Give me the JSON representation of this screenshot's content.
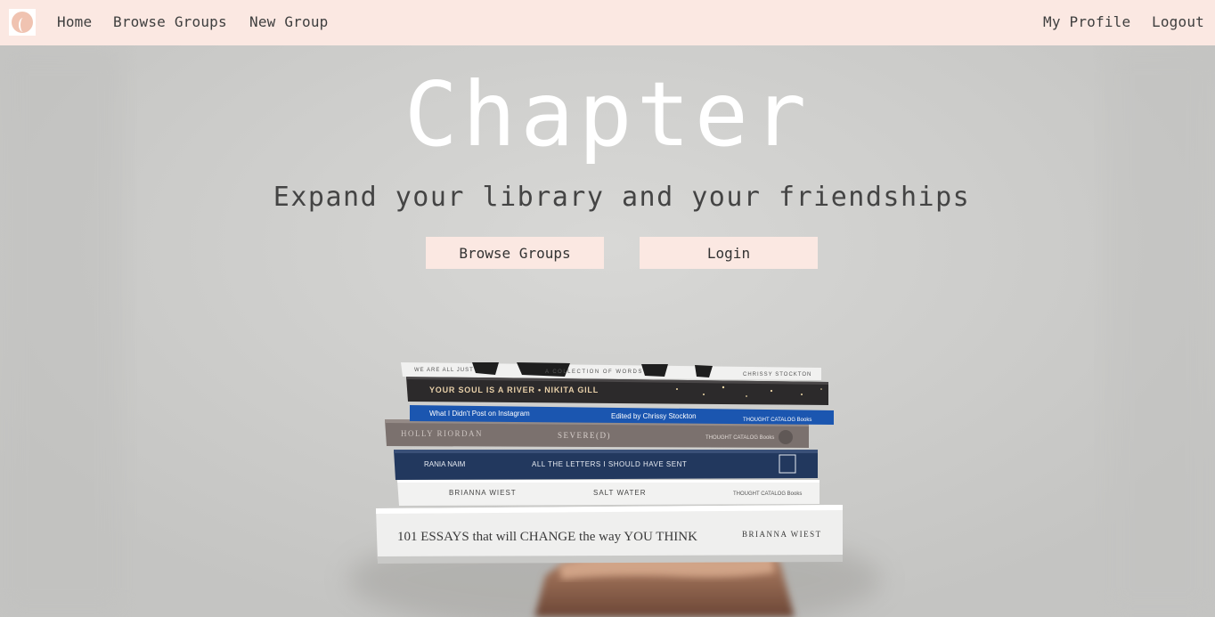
{
  "nav": {
    "logo_icon": "crescent-moon-logo-icon",
    "home": "Home",
    "browse_groups": "Browse Groups",
    "new_group": "New Group",
    "my_profile": "My Profile",
    "logout": "Logout"
  },
  "hero": {
    "title": "Chapter",
    "subtitle": "Expand your library and your friendships",
    "browse_button": "Browse Groups",
    "login_button": "Login"
  },
  "books": [
    {
      "spine_left": "WE ARE ALL JUST",
      "spine_mid": "A COLLECTION OF WORDS",
      "spine_right": "CHRISSY STOCKTON"
    },
    {
      "spine_left": "YOUR SOUL IS A RIVER  •  NIKITA GILL",
      "spine_mid": "",
      "spine_right": ""
    },
    {
      "spine_left": "What I Didn't Post on Instagram",
      "spine_mid": "Edited by Chrissy Stockton",
      "spine_right": "THOUGHT CATALOG Books"
    },
    {
      "spine_left": "HOLLY RIORDAN",
      "spine_mid": "SEVERE(D)",
      "spine_right": "THOUGHT CATALOG Books"
    },
    {
      "spine_left": "RANIA NAIM",
      "spine_mid": "ALL THE LETTERS I SHOULD HAVE SENT",
      "spine_right": ""
    },
    {
      "spine_left": "BRIANNA WIEST",
      "spine_mid": "SALT WATER",
      "spine_right": "THOUGHT CATALOG Books"
    },
    {
      "spine_left": "101 ESSAYS that will CHANGE the way YOU THINK",
      "spine_mid": "",
      "spine_right": "BRIANNA WIEST"
    }
  ],
  "colors": {
    "nav_bg": "#fbe8e2",
    "button_bg": "#fbe8e2",
    "title": "#ffffff",
    "subtitle": "#444444",
    "logo": "#f0c3b1"
  }
}
